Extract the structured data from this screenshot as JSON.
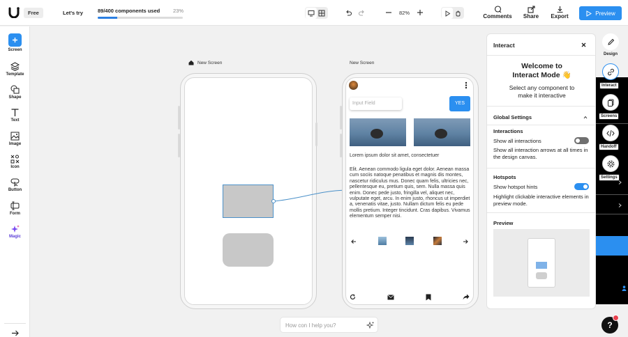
{
  "header": {
    "plan_label": "Free",
    "lets_try": "Let's try",
    "usage_label": "89/400 components used",
    "usage_percent_label": "23%",
    "usage_fraction": 0.23,
    "zoom": "82%",
    "comments": "Comments",
    "share": "Share",
    "export": "Export",
    "preview": "Preview"
  },
  "left_tools": [
    {
      "label": "Screen",
      "icon": "plus-icon"
    },
    {
      "label": "Template",
      "icon": "layers-icon"
    },
    {
      "label": "Shape",
      "icon": "shape-icon"
    },
    {
      "label": "Text",
      "icon": "text-icon"
    },
    {
      "label": "Image",
      "icon": "image-icon"
    },
    {
      "label": "Icon",
      "icon": "icon-grid-icon"
    },
    {
      "label": "Button",
      "icon": "button-icon"
    },
    {
      "label": "Form",
      "icon": "form-icon"
    },
    {
      "label": "Magic",
      "icon": "sparkle-icon"
    }
  ],
  "canvas": {
    "screen1_label": "New Screen",
    "screen2_label": "New Screen",
    "input_placeholder": "Input Field",
    "yes_button": "YES",
    "lorem_title": "Lorem ipsum dolor sit amet, consectetuer",
    "lorem_body": "Elit. Aenean commodo ligula eget dolor. Aenean massa cum sociis natoque penatibus et magnis dis montes, nascetur ridiculus mus. Donec quam felis, ultricies nec, pellentesque eu, pretium quis, sem. Nulla massa quis enim. Donec pede justo, fringilla vel, aliquet nec, vulputate eget, arcu. In enim justo, rhoncus ut imperdiet a, venenatis vitae, justo. Nullam dictum felis eu pede mollis pretium. Integer tincidunt. Cras dapibus. Vivamus elementum semper nisi."
  },
  "interact_panel": {
    "title": "Interact",
    "welcome_line1": "Welcome to",
    "welcome_line2": "Interact Mode 👋",
    "select_hint": "Select any component to make it interactive",
    "global_settings": "Global Settings",
    "interactions_heading": "Interactions",
    "show_all_interactions": "Show all interactions",
    "show_interaction_arrows": "Show all interaction arrows at all times in the design canvas.",
    "hotspots_heading": "Hotspots",
    "show_hotspot_hints": "Show hotspot hints",
    "highlight_clickable": "Highlight clickable interactive elements in preview mode.",
    "preview_heading": "Preview",
    "show_all_interactions_on": false,
    "show_hotspot_hints_on": true
  },
  "right_tools": [
    {
      "label": "Design",
      "icon": "pencil-icon"
    },
    {
      "label": "Interact",
      "icon": "link-icon"
    },
    {
      "label": "Screens",
      "icon": "screens-icon"
    },
    {
      "label": "Handoff",
      "icon": "code-icon"
    },
    {
      "label": "Settings",
      "icon": "gear-icon"
    }
  ],
  "chat": {
    "placeholder": "How con I help you?"
  },
  "help_label": "?",
  "colors": {
    "accent": "#2b8ff0",
    "link": "#4a90c8",
    "shape_selected": "#c8c8c8"
  }
}
